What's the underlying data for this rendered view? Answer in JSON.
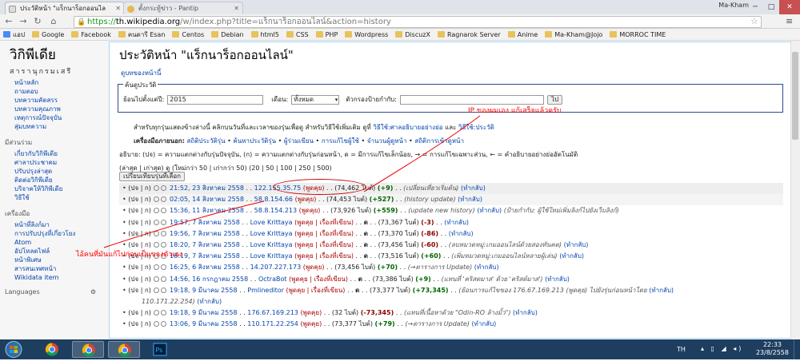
{
  "browser": {
    "tabs": [
      {
        "title": "ประวัติหน้า \"แร็กนาร็อกออนไล",
        "active": true
      },
      {
        "title": "ตั้งกระทู้ข่าว - Pantip",
        "active": false
      }
    ],
    "user": "Ma-Kham",
    "url_scheme": "https://",
    "url_host": "th.wikipedia.org",
    "url_path": "/w/index.php?title=แร็กนาร็อกออนไลน์&action=history",
    "bookmarks": [
      "แอป",
      "Google",
      "Facebook",
      "คนดารี Esan",
      "Centos",
      "Debian",
      "html5",
      "CSS",
      "PHP",
      "Wordpress",
      "DiscuzX",
      "Ragnarok Server",
      "Anime",
      "Ma-Kham@Jojo",
      "MORROC TIME"
    ]
  },
  "logo": {
    "title": "วิกิพีเดีย",
    "subtitle": "สารานุกรมเสรี"
  },
  "sidebar": {
    "main": [
      "หน้าหลัก",
      "ถามตอบ",
      "บทความคัดสรร",
      "บทความคุณภาพ",
      "เหตุการณ์ปัจจุบัน",
      "สุ่มบทความ"
    ],
    "participate_title": "มีส่วนร่วม",
    "participate": [
      "เกี่ยวกับวิกิพีเดีย",
      "ศาลาประชาคม",
      "ปรับปรุงล่าสุด",
      "ติดต่อวิกิพีเดีย",
      "บริจาคให้วิกิพีเดีย",
      "วิธีใช้"
    ],
    "tools_title": "เครื่องมือ",
    "tools": [
      "หน้าที่ลิงก์มา",
      "การปรับปรุงที่เกี่ยวโยง",
      "Atom",
      "อัปโหลดไฟล์",
      "หน้าพิเศษ",
      "สารสนเทศหน้า",
      "Wikidata item"
    ],
    "languages": "Languages"
  },
  "page": {
    "title": "ประวัติหน้า \"แร็กนาร็อกออนไลน์\"",
    "subtitle": "ดูบทของหน้านี้",
    "form": {
      "legend": "ค้นดูประวัติ",
      "from_label": "ย้อนไปตั้งแต่ปี:",
      "year_value": "2015",
      "month_label": "เดือน:",
      "month_value": "ทั้งหมด",
      "tag_label": "ตัวกรองป้ายกำกับ:",
      "tag_value": "",
      "go_button": "ไป"
    },
    "info_line": "สำหรับทุกรุ่นแสดงข้างล่างนี้ คลิกบนวันที่และเวลาของรุ่นเพื่อดู สำหรับวิธีใช้เพิ่มเติม ดูที่",
    "info_link1": "วิธีใช้:ศาลอธิบายอย่างย่อ",
    "info_and": "และ",
    "info_link2": "วิธีใช้:ประวัติ",
    "tools_label": "เครื่องมือภายนอก:",
    "external_tools": [
      "สถิติประวัติรุ่น",
      "ค้นหาประวัติรุ่น",
      "ผู้ร่วมเขียน",
      "การแก้ไขผู้ใช้",
      "จำนวนผู้ดูหน้า",
      "สถิติการเข้าดูหน้า"
    ],
    "legend_text": "อธิบาย: (ปจ) = ความแตกต่างกับรุ่นปัจจุบัน, (ก) = ความแตกต่างกับรุ่นก่อนหน้า, ด = มีการแก้ไขเล็กน้อย, → = การแก้ไขเฉพาะส่วน, ← = คำอธิบายอย่างย่ออัตโนมัติ",
    "pager_text": "(ล่าสุด | เก่าสุด) ดู (ใหม่กว่า 50 | เก่ากว่า 50) (20 | 50 | 100 | 250 | 500)",
    "compare_button": "เปรียบเทียบรุ่นที่เลือก"
  },
  "history": [
    {
      "date": "21:52, 23 สิงหาคม 2558",
      "user": "122.155.35.75",
      "talk": "(พูดคุย)",
      "size": "(74,462 ไบต์)",
      "diff": "(+9)",
      "sign": "pos",
      "comment": "(เปลี่ยนเที่ยวเริ่มต้น)",
      "undo": "(ทำกลับ)"
    },
    {
      "date": "02:05, 14 สิงหาคม 2558",
      "user": "58.8.154.66",
      "talk": "(พูดคุย)",
      "size": "(74,453 ไบต์)",
      "diff": "(+527)",
      "sign": "pos",
      "comment": "(history update)",
      "undo": "(ทำกลับ)"
    },
    {
      "date": "15:36, 11 สิงหาคม 2558",
      "user": "58.8.154.213",
      "talk": "(พูดคุย)",
      "size": "(73,926 ไบต์)",
      "diff": "(+559)",
      "sign": "pos",
      "comment": "(update new history)",
      "undo": "(ทำกลับ)",
      "extra": "(ป้ายกำกับ: ผู้ใช้ใหม่เพิ่มลิงก์ไปยังเว็บลิงก์)"
    },
    {
      "date": "19:57, 7 สิงหาคม 2558",
      "user": "Love Krittaya",
      "talk": "(พูดคุย | เรื่องที่เขียน)",
      "minor": "ด",
      "size": "(73,367 ไบต์)",
      "diff": "(-3)",
      "sign": "neg",
      "comment": "",
      "undo": "(ทำกลับ)"
    },
    {
      "date": "19:56, 7 สิงหาคม 2558",
      "user": "Love Krittaya",
      "talk": "(พูดคุย | เรื่องที่เขียน)",
      "minor": "ด",
      "size": "(73,370 ไบต์)",
      "diff": "(-86)",
      "sign": "neg",
      "comment": "",
      "undo": "(ทำกลับ)"
    },
    {
      "date": "18:20, 7 สิงหาคม 2558",
      "user": "Love Krittaya",
      "talk": "(พูดคุย | เรื่องที่เขียน)",
      "minor": "ด",
      "size": "(73,456 ไบต์)",
      "diff": "(-60)",
      "sign": "neg",
      "comment": "(ลบหมวดหมู่:เกมออนไลน์ด้วยสองทันคต)",
      "undo": "(ทำกลับ)"
    },
    {
      "date": "18:19, 7 สิงหาคม 2558",
      "user": "Love Krittaya",
      "talk": "(พูดคุย | เรื่องที่เขียน)",
      "minor": "ด",
      "size": "(73,516 ไบต์)",
      "diff": "(+60)",
      "sign": "pos",
      "comment": "(เพิ่มหมวดหมู่:เกมออนไลน์หลายผู้เล่น)",
      "undo": "(ทำกลับ)"
    },
    {
      "date": "16:25, 6 สิงหาคม 2558",
      "user": "14.207.227.173",
      "talk": "(พูดคุย)",
      "size": "(73,456 ไบต์)",
      "diff": "(+70)",
      "sign": "pos",
      "comment": "(→ตารางการ Update)",
      "undo": "(ทำกลับ)"
    },
    {
      "date": "14:56, 16 กรกฎาคม 2558",
      "user": "OctraBot",
      "talk": "(พูดคุย | เรื่องที่เขียน)",
      "minor": "ด",
      "size": "(73,386 ไบต์)",
      "diff": "(+9)",
      "sign": "pos",
      "comment": "(แทนที่ 'คริสตมาส' ด้วย 'คริสต์มาส')",
      "undo": "(ทำกลับ)"
    },
    {
      "date": "19:18, 9 มีนาคม 2558",
      "user": "Pmlineditor",
      "talk": "(พูดคุย | เรื่องที่เขียน)",
      "minor": "ด",
      "size": "(73,377 ไบต์)",
      "diff": "(+73,345)",
      "sign": "pos",
      "comment": "(ย้อนการแก้ไขของ 176.67.169.213 (พูดคุย) ไปยังรุ่นก่อนหน้าโดย",
      "undo": "(ทำกลับ)",
      "cont": "110.171.22.254)"
    },
    {
      "date": "19:18, 9 มีนาคม 2558",
      "user": "176.67.169.213",
      "talk": "(พูดคุย)",
      "size": "(32 ไบต์)",
      "diff": "(-73,345)",
      "sign": "neg",
      "comment": "(แทนที่เนื้อหาด้วย \"Odin-RO ล้างมั้ว\")",
      "undo": "(ทำกลับ)"
    },
    {
      "date": "13:06, 9 มีนาคม 2558",
      "user": "110.171.22.254",
      "talk": "(พูดคุย)",
      "size": "(73,377 ไบต์)",
      "diff": "(+79)",
      "sign": "pos",
      "comment": "(→ตารางการ Update)",
      "undo": "(ทำกลับ)"
    }
  ],
  "annotations": {
    "note_own_ip": "IP ของผมเอง แก้เสร็จแล้วครับ",
    "note_others": "ไอ้คนที่มันแก้ไปก่อนเป็นของตัวเอง"
  },
  "taskbar": {
    "lang": "TH",
    "time": "22:33",
    "date": "23/8/2558"
  },
  "colors": {
    "link": "#0645ad",
    "annotation": "#ff0000",
    "taskbar": "#1e3e60"
  }
}
